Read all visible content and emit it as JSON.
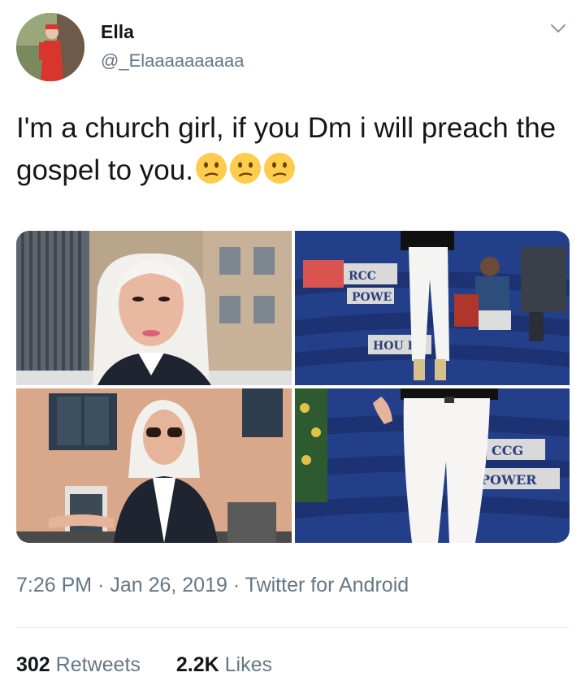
{
  "author": {
    "display_name": "Ella",
    "handle": "@_Elaaaaaaaaaa"
  },
  "tweet": {
    "text": "I'm a church girl, if you Dm i will preach the gospel to you.",
    "emojis": [
      "confused-face",
      "confused-face",
      "confused-face"
    ]
  },
  "media": {
    "photos": [
      {
        "name": "photo-1"
      },
      {
        "name": "photo-2",
        "sign_text_1": "RCC",
        "sign_text_2": "POWE",
        "sign_text_3": "HOU E"
      },
      {
        "name": "photo-3"
      },
      {
        "name": "photo-4",
        "sign_text_1": "CCG",
        "sign_text_2": "POWER"
      }
    ]
  },
  "meta": {
    "time": "7:26 PM",
    "date": "Jan 26, 2019",
    "source": "Twitter for Android",
    "separator": " · "
  },
  "stats": {
    "retweets_count": "302",
    "retweets_label": "Retweets",
    "likes_count": "2.2K",
    "likes_label": "Likes"
  },
  "colors": {
    "text_primary": "#14171a",
    "text_secondary": "#657786",
    "divider": "#e1e8ed",
    "emoji_yellow": "#ffcc4d"
  }
}
